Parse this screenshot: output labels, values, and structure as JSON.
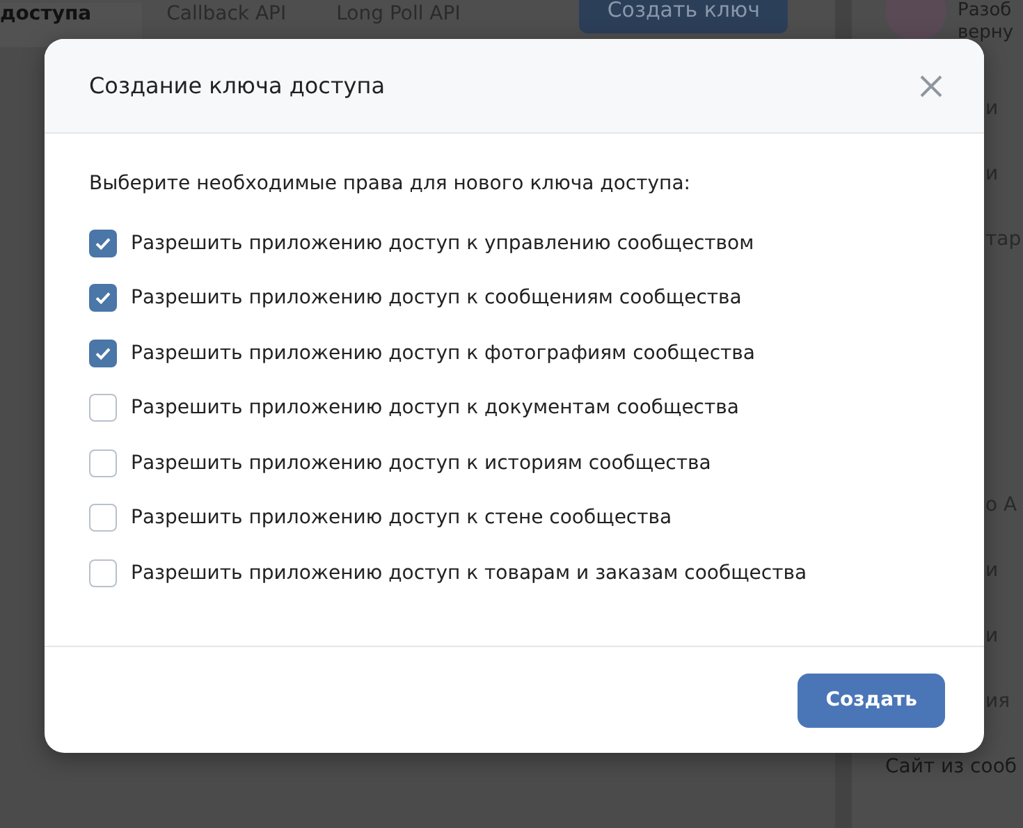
{
  "top_tabs": [
    {
      "label": "доступа",
      "selected": true
    },
    {
      "label": "Callback API",
      "selected": false
    },
    {
      "label": "Long Poll API",
      "selected": false
    }
  ],
  "top_button": "Создать ключ",
  "sidebar": {
    "profile_lines": [
      "Разоб",
      "верну"
    ],
    "items": [
      {
        "label": "и"
      },
      {
        "label": "и"
      },
      {
        "label": "тар"
      },
      {
        "label": "о A"
      },
      {
        "label": "и"
      },
      {
        "label": "и"
      },
      {
        "label": "ия"
      },
      {
        "label": "Сайт из сооб"
      }
    ]
  },
  "dialog": {
    "title": "Создание ключа доступа",
    "intro": "Выберите необходимые права для нового ключа доступа:",
    "permissions": [
      {
        "label": "Разрешить приложению доступ к управлению сообществом",
        "checked": true
      },
      {
        "label": "Разрешить приложению доступ к сообщениям сообщества",
        "checked": true
      },
      {
        "label": "Разрешить приложению доступ к фотографиям сообщества",
        "checked": true
      },
      {
        "label": "Разрешить приложению доступ к документам сообщества",
        "checked": false
      },
      {
        "label": "Разрешить приложению доступ к историям сообщества",
        "checked": false
      },
      {
        "label": "Разрешить приложению доступ к стене сообщества",
        "checked": false
      },
      {
        "label": "Разрешить приложению доступ к товарам и заказам сообщества",
        "checked": false
      }
    ],
    "submit": "Создать"
  }
}
